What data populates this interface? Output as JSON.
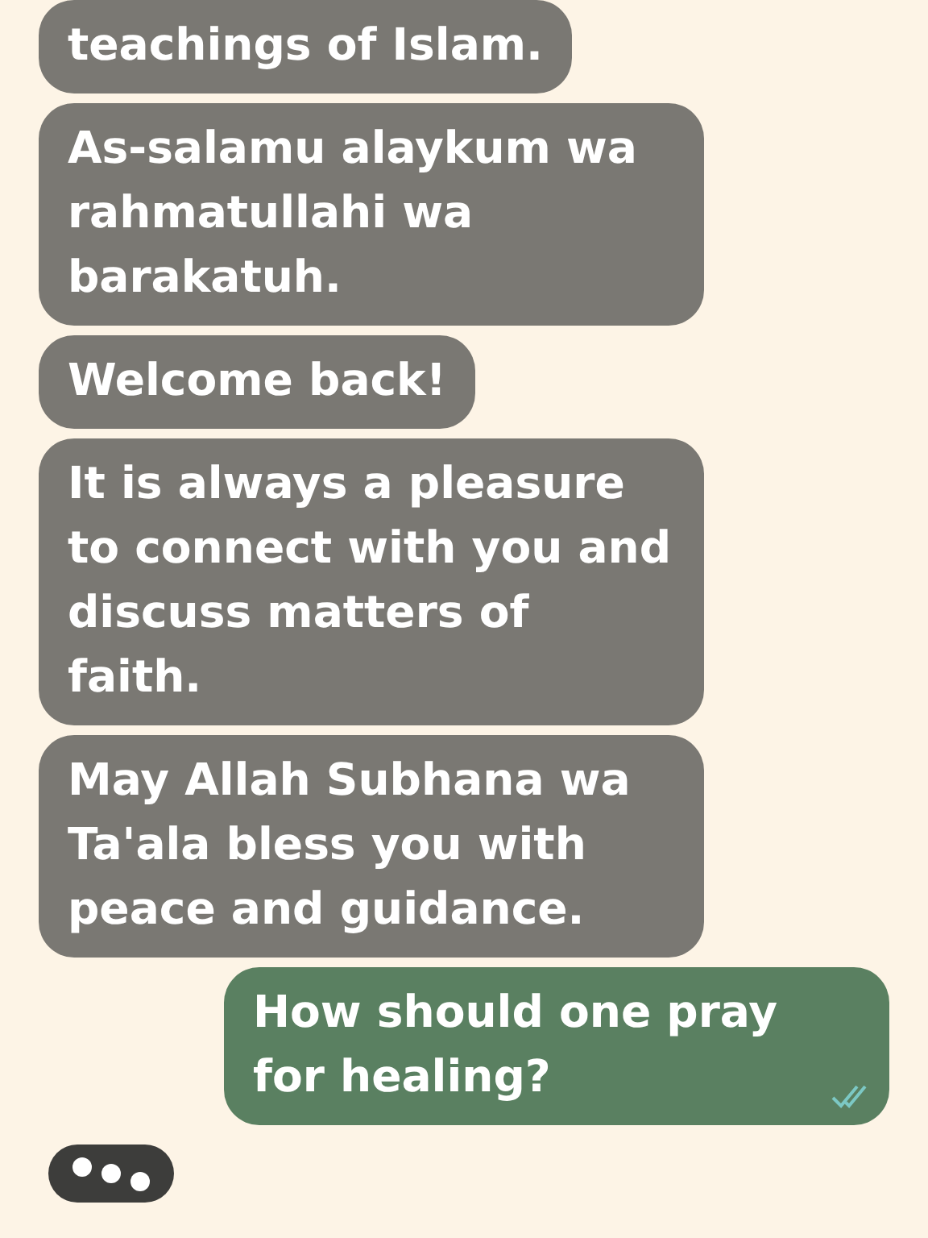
{
  "messages": [
    {
      "kind": "incoming",
      "text": "teachings of Islam."
    },
    {
      "kind": "incoming",
      "text": "As-salamu alaykum wa rahmatullahi wa barakatuh."
    },
    {
      "kind": "incoming",
      "text": "Welcome back!"
    },
    {
      "kind": "incoming",
      "text": "It is always a pleasure to connect with you and discuss matters of faith."
    },
    {
      "kind": "incoming",
      "text": "May Allah Subhana wa Ta'ala bless you with peace and guidance."
    },
    {
      "kind": "outgoing",
      "text": "How should one pray for healing?",
      "read": true
    }
  ],
  "typing": true
}
